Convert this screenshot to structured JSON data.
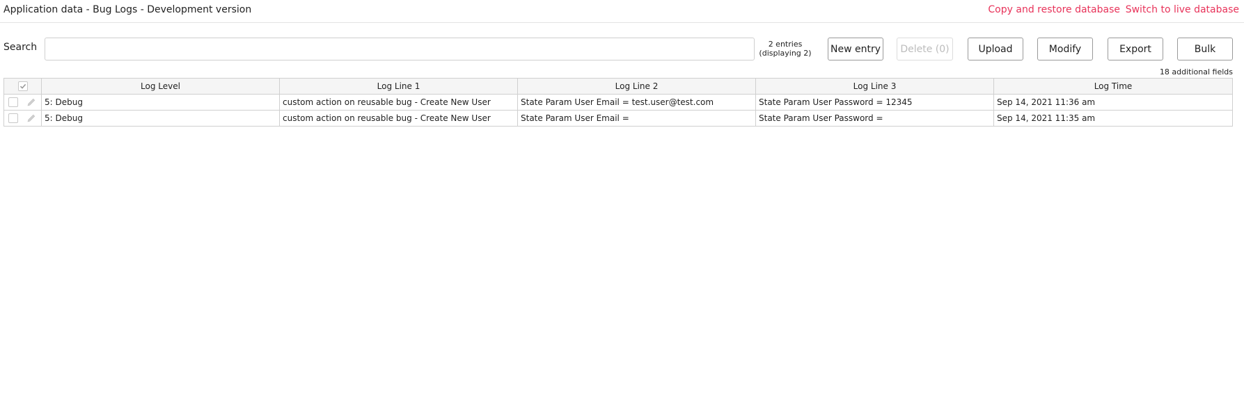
{
  "header": {
    "title": "Application data - Bug Logs - Development version",
    "copy_restore_link": "Copy and restore database",
    "switch_live_link": "Switch to live database"
  },
  "toolbar": {
    "search_label": "Search",
    "search_value": "",
    "search_placeholder": "",
    "entries_count": "2 entries",
    "entries_displaying": "(displaying 2)",
    "new_entry_label": "New entry",
    "delete_label": "Delete (0)",
    "upload_label": "Upload",
    "modify_label": "Modify",
    "export_label": "Export",
    "bulk_label": "Bulk"
  },
  "table": {
    "additional_fields": "18 additional fields",
    "columns": [
      "Log Level",
      "Log Line 1",
      "Log Line 2",
      "Log Line 3",
      "Log Time"
    ],
    "rows": [
      {
        "log_level": "5: Debug",
        "log_line_1": "custom action on reusable bug - Create New User",
        "log_line_2": "State Param User Email = test.user@test.com",
        "log_line_3": "State Param User Password = 12345",
        "log_time": "Sep 14, 2021 11:36 am"
      },
      {
        "log_level": "5: Debug",
        "log_line_1": "custom action on reusable bug - Create New User",
        "log_line_2": "State Param User Email =",
        "log_line_3": "State Param User Password =",
        "log_time": "Sep 14, 2021 11:35 am"
      }
    ]
  },
  "icons": {
    "select_all": "checkmark-icon",
    "row_select": "checkbox-icon",
    "row_edit": "pencil-icon"
  },
  "colors": {
    "link": "#e8335a",
    "border": "#cfcfcf",
    "header_bg": "#f5f5f5",
    "disabled_text": "#bcbcbc"
  }
}
